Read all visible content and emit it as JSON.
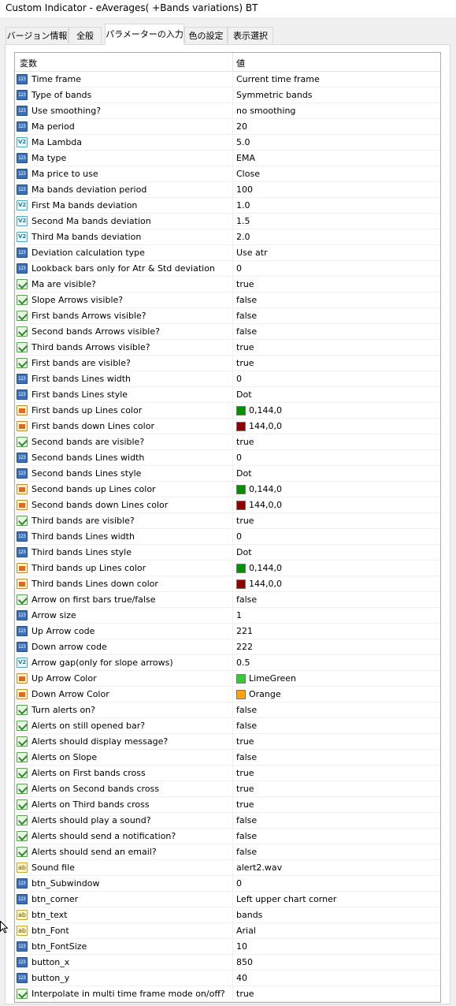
{
  "window": {
    "title": "Custom Indicator - eAverages( +Bands variations) BT"
  },
  "tabs": [
    {
      "label": "バージョン情報",
      "active": false
    },
    {
      "label": "全般",
      "active": false
    },
    {
      "label": "パラメーターの入力",
      "active": true
    },
    {
      "label": "色の設定",
      "active": false
    },
    {
      "label": "表示選択",
      "active": false
    }
  ],
  "grid": {
    "headers": {
      "variable": "変数",
      "value": "値"
    },
    "rows": [
      {
        "icon": "integer-type-icon",
        "label": "Time frame",
        "value": "Current time frame"
      },
      {
        "icon": "integer-type-icon",
        "label": "Type of bands",
        "value": "Symmetric bands"
      },
      {
        "icon": "integer-type-icon",
        "label": "Use smoothing?",
        "value": "no smoothing"
      },
      {
        "icon": "integer-type-icon",
        "label": "Ma period",
        "value": "20"
      },
      {
        "icon": "double-type-icon",
        "label": "Ma Lambda",
        "value": "5.0"
      },
      {
        "icon": "integer-type-icon",
        "label": "Ma type",
        "value": "EMA"
      },
      {
        "icon": "integer-type-icon",
        "label": "Ma price to use",
        "value": "Close"
      },
      {
        "icon": "integer-type-icon",
        "label": "Ma  bands deviation period",
        "value": "100"
      },
      {
        "icon": "double-type-icon",
        "label": "First Ma bands deviation",
        "value": "1.0"
      },
      {
        "icon": "double-type-icon",
        "label": "Second Ma bands deviation",
        "value": "1.5"
      },
      {
        "icon": "double-type-icon",
        "label": "Third Ma bands deviation",
        "value": "2.0"
      },
      {
        "icon": "integer-type-icon",
        "label": "Deviation calculation type",
        "value": "Use atr"
      },
      {
        "icon": "integer-type-icon",
        "label": "Lookback bars only for Atr & Std deviation",
        "value": "0"
      },
      {
        "icon": "boolean-type-icon",
        "label": "Ma are visible?",
        "value": "true"
      },
      {
        "icon": "boolean-type-icon",
        "label": "Slope Arrows visible?",
        "value": "false"
      },
      {
        "icon": "boolean-type-icon",
        "label": "First bands Arrows visible?",
        "value": "false"
      },
      {
        "icon": "boolean-type-icon",
        "label": "Second bands Arrows visible?",
        "value": "false"
      },
      {
        "icon": "boolean-type-icon",
        "label": "Third bands Arrows visible?",
        "value": "true"
      },
      {
        "icon": "boolean-type-icon",
        "label": "First bands are visible?",
        "value": "true"
      },
      {
        "icon": "integer-type-icon",
        "label": "First bands Lines width",
        "value": "0"
      },
      {
        "icon": "integer-type-icon",
        "label": "First bands Lines style",
        "value": "Dot"
      },
      {
        "icon": "color-type-icon",
        "label": "First bands up Lines color",
        "value": "0,144,0",
        "swatch": "#009000"
      },
      {
        "icon": "color-type-icon",
        "label": "First bands down Lines color",
        "value": "144,0,0",
        "swatch": "#900000"
      },
      {
        "icon": "boolean-type-icon",
        "label": "Second bands are visible?",
        "value": "true"
      },
      {
        "icon": "integer-type-icon",
        "label": "Second bands Lines width",
        "value": "0"
      },
      {
        "icon": "integer-type-icon",
        "label": "Second bands Lines style",
        "value": "Dot"
      },
      {
        "icon": "color-type-icon",
        "label": "Second bands up Lines color",
        "value": "0,144,0",
        "swatch": "#009000"
      },
      {
        "icon": "color-type-icon",
        "label": "Second bands down Lines color",
        "value": "144,0,0",
        "swatch": "#900000"
      },
      {
        "icon": "boolean-type-icon",
        "label": "Third bands are visible?",
        "value": "true"
      },
      {
        "icon": "integer-type-icon",
        "label": "Third bands Lines width",
        "value": "0"
      },
      {
        "icon": "integer-type-icon",
        "label": "Third bands Lines style",
        "value": "Dot"
      },
      {
        "icon": "color-type-icon",
        "label": "Third bands up Lines color",
        "value": "0,144,0",
        "swatch": "#009000"
      },
      {
        "icon": "color-type-icon",
        "label": "Third bands Lines down color",
        "value": "144,0,0",
        "swatch": "#900000"
      },
      {
        "icon": "boolean-type-icon",
        "label": "Arrow on first bars true/false",
        "value": "false"
      },
      {
        "icon": "integer-type-icon",
        "label": "Arrow size",
        "value": "1"
      },
      {
        "icon": "integer-type-icon",
        "label": "Up Arrow code",
        "value": "221"
      },
      {
        "icon": "integer-type-icon",
        "label": "Down arrow code",
        "value": "222"
      },
      {
        "icon": "double-type-icon",
        "label": "Arrow gap(only for slope arrows)",
        "value": "0.5"
      },
      {
        "icon": "color-type-icon",
        "label": "Up Arrow Color",
        "value": "LimeGreen",
        "swatch": "#32cd32"
      },
      {
        "icon": "color-type-icon",
        "label": "Down Arrow Color",
        "value": "Orange",
        "swatch": "#ffa500"
      },
      {
        "icon": "boolean-type-icon",
        "label": "Turn alerts on?",
        "value": "false"
      },
      {
        "icon": "boolean-type-icon",
        "label": "Alerts on still opened bar?",
        "value": "false"
      },
      {
        "icon": "boolean-type-icon",
        "label": "Alerts should display message?",
        "value": "true"
      },
      {
        "icon": "boolean-type-icon",
        "label": "Alerts on  Slope",
        "value": "false"
      },
      {
        "icon": "boolean-type-icon",
        "label": "Alerts on  First bands cross",
        "value": "true"
      },
      {
        "icon": "boolean-type-icon",
        "label": "Alerts on Second bands cross",
        "value": "true"
      },
      {
        "icon": "boolean-type-icon",
        "label": "Alerts on  Third bands cross",
        "value": "true"
      },
      {
        "icon": "boolean-type-icon",
        "label": "Alerts should play a sound?",
        "value": "false"
      },
      {
        "icon": "boolean-type-icon",
        "label": "Alerts should send a notification?",
        "value": "false"
      },
      {
        "icon": "boolean-type-icon",
        "label": "Alerts should send an email?",
        "value": "false"
      },
      {
        "icon": "string-type-icon",
        "label": "Sound file",
        "value": "alert2.wav"
      },
      {
        "icon": "integer-type-icon",
        "label": "btn_Subwindow",
        "value": "0"
      },
      {
        "icon": "integer-type-icon",
        "label": "btn_corner",
        "value": "Left upper chart corner"
      },
      {
        "icon": "string-type-icon",
        "label": "btn_text",
        "value": "bands"
      },
      {
        "icon": "string-type-icon",
        "label": "btn_Font",
        "value": "Arial"
      },
      {
        "icon": "integer-type-icon",
        "label": "btn_FontSize",
        "value": "10"
      },
      {
        "icon": "integer-type-icon",
        "label": "button_x",
        "value": "850"
      },
      {
        "icon": "integer-type-icon",
        "label": "button_y",
        "value": "40"
      },
      {
        "icon": "boolean-type-icon",
        "label": "Interpolate in multi time frame mode on/off?",
        "value": "true"
      }
    ]
  }
}
